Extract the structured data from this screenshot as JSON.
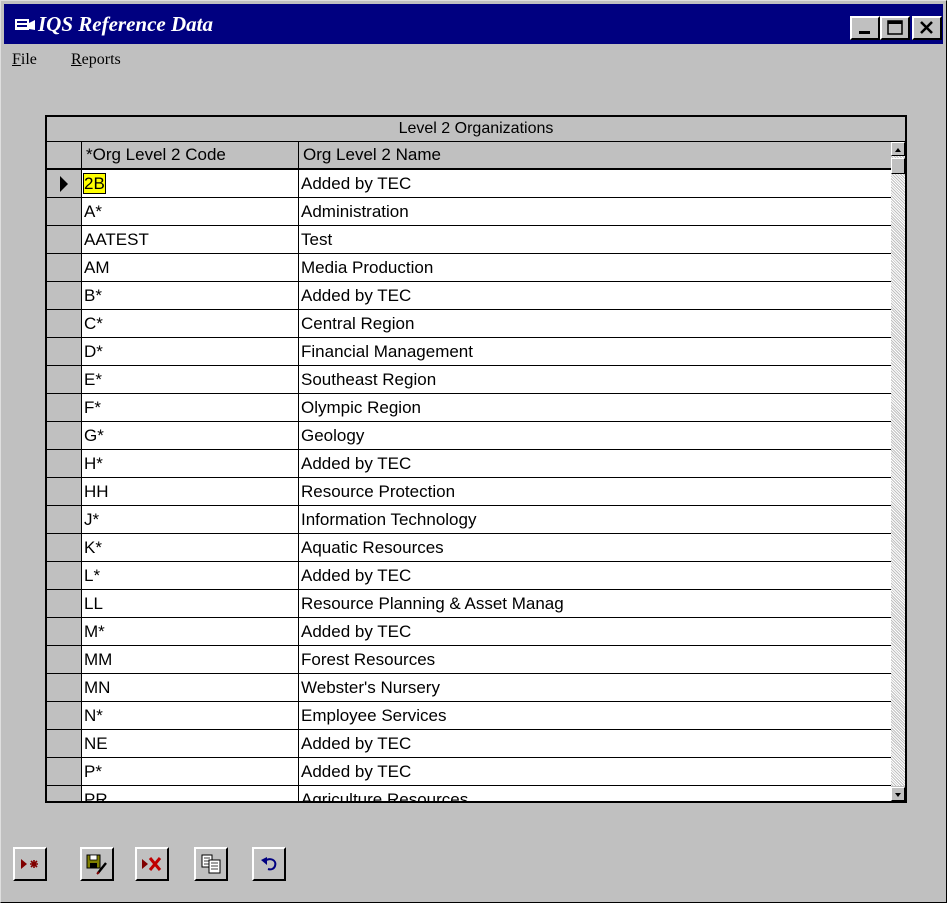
{
  "window": {
    "title": "IQS Reference Data",
    "controls": {
      "minimize_icon": "minimize-icon",
      "maximize_icon": "maximize-icon",
      "close_icon": "close-icon"
    }
  },
  "menu": {
    "file": "File",
    "reports": "Reports"
  },
  "grid": {
    "caption": "Level 2 Organizations",
    "columns": [
      "*Org Level 2 Code",
      "Org Level 2 Name"
    ],
    "rows": [
      [
        "2B",
        "Added by TEC"
      ],
      [
        "A*",
        "Administration"
      ],
      [
        "AATEST",
        "Test"
      ],
      [
        "AM",
        "Media Production"
      ],
      [
        "B*",
        "Added by TEC"
      ],
      [
        "C*",
        "Central Region"
      ],
      [
        "D*",
        "Financial Management"
      ],
      [
        "E*",
        "Southeast Region"
      ],
      [
        "F*",
        "Olympic Region"
      ],
      [
        "G*",
        "Geology"
      ],
      [
        "H*",
        "Added by TEC"
      ],
      [
        "HH",
        "Resource Protection"
      ],
      [
        "J*",
        "Information Technology"
      ],
      [
        "K*",
        "Aquatic Resources"
      ],
      [
        "L*",
        "Added by TEC"
      ],
      [
        "LL",
        "Resource Planning & Asset Manag"
      ],
      [
        "M*",
        "Added by TEC"
      ],
      [
        "MM",
        "Forest Resources"
      ],
      [
        "MN",
        "Webster's Nursery"
      ],
      [
        "N*",
        "Employee Services"
      ],
      [
        "NE",
        "Added by TEC"
      ],
      [
        "P*",
        "Added by TEC"
      ],
      [
        "PR",
        "Agriculture Resources"
      ]
    ],
    "selected_row": 0
  },
  "toolbar": {
    "buttons": [
      {
        "name": "new-record-button",
        "icon": "new-record-icon"
      },
      {
        "name": "save-record-button",
        "icon": "save-edit-icon"
      },
      {
        "name": "delete-record-button",
        "icon": "delete-record-icon"
      },
      {
        "name": "copy-record-button",
        "icon": "copy-icon"
      },
      {
        "name": "undo-button",
        "icon": "undo-icon"
      }
    ]
  },
  "colors": {
    "titlebar": "#000080",
    "face": "#c0c0c0",
    "highlight": "#ffff00"
  }
}
